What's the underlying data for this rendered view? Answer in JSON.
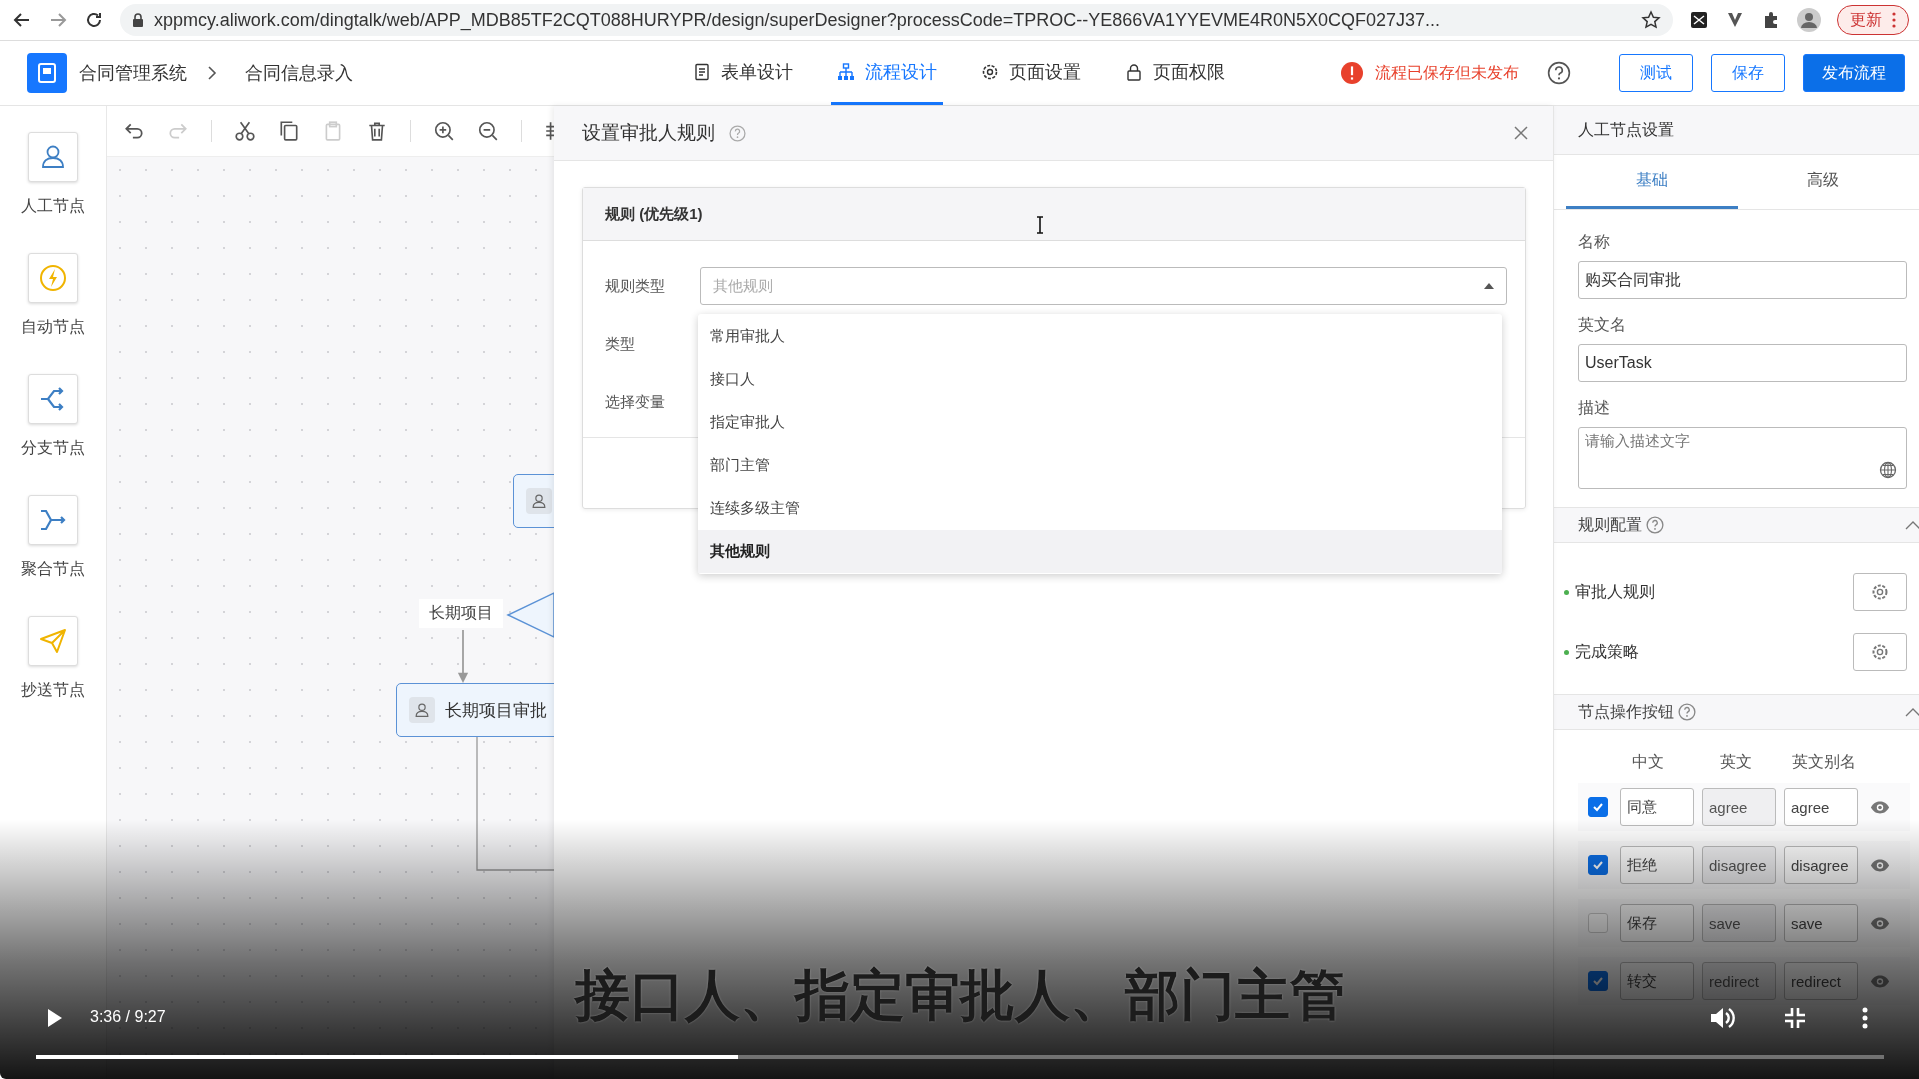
{
  "browser": {
    "url": "xppmcy.aliwork.com/dingtalk/web/APP_MDB85TF2CQT088HURYPR/design/superDesigner?processCode=TPROC--YE866VA1YYEVME4R0N5X0CQF027J37...",
    "update_button": "更新"
  },
  "header": {
    "breadcrumbs": [
      "合同管理系统",
      "合同信息录入"
    ],
    "tabs": [
      {
        "label": "表单设计",
        "kind": "form",
        "selected": false
      },
      {
        "label": "流程设计",
        "kind": "flow",
        "selected": true
      },
      {
        "label": "页面设置",
        "kind": "settings",
        "selected": false
      },
      {
        "label": "页面权限",
        "kind": "lock",
        "selected": false
      }
    ],
    "status": "流程已保存但未发布",
    "buttons": [
      {
        "label": "测试",
        "kind": "outline"
      },
      {
        "label": "保存",
        "kind": "outline"
      },
      {
        "label": "发布流程",
        "kind": "primary"
      }
    ]
  },
  "node_palette": [
    {
      "label": "人工节点",
      "kind": "person"
    },
    {
      "label": "自动节点",
      "kind": "auto"
    },
    {
      "label": "分支节点",
      "kind": "branch"
    },
    {
      "label": "聚合节点",
      "kind": "merge"
    },
    {
      "label": "抄送节点",
      "kind": "send"
    }
  ],
  "canvas": {
    "branch_label": "长期项目",
    "task_node": "长期项目审批"
  },
  "dialog": {
    "title": "设置审批人规则",
    "card_title": "规则 (优先级1)",
    "fields": [
      "规则类型",
      "类型",
      "选择变量"
    ],
    "select_value": "其他规则",
    "options": [
      {
        "label": "常用审批人",
        "selected": false
      },
      {
        "label": "接口人",
        "selected": false
      },
      {
        "label": "指定审批人",
        "selected": false
      },
      {
        "label": "部门主管",
        "selected": false
      },
      {
        "label": "连续多级主管",
        "selected": false
      },
      {
        "label": "其他规则",
        "selected": true
      }
    ]
  },
  "settings_panel": {
    "title": "人工节点设置",
    "tabs": [
      {
        "label": "基础",
        "selected": true
      },
      {
        "label": "高级",
        "selected": false
      }
    ],
    "name_label": "名称",
    "name_value": "购买合同审批",
    "en_label": "英文名",
    "en_value": "UserTask",
    "desc_label": "描述",
    "desc_placeholder": "请输入描述文字",
    "rule_section": "规则配置",
    "rules": [
      "审批人规则",
      "完成策略"
    ],
    "button_section": "节点操作按钮",
    "columns": [
      "中文",
      "英文",
      "英文别名"
    ],
    "buttons": [
      {
        "checked": true,
        "zh": "同意",
        "en": "agree",
        "alias": "agree"
      },
      {
        "checked": true,
        "zh": "拒绝",
        "en": "disagree",
        "alias": "disagree"
      },
      {
        "checked": false,
        "zh": "保存",
        "en": "save",
        "alias": "save"
      },
      {
        "checked": true,
        "zh": "转交",
        "en": "redirect",
        "alias": "redirect"
      }
    ]
  },
  "subtitle": "接口人、指定审批人、部门主管",
  "player": {
    "time": "3:36 / 9:27",
    "level": 0.38
  }
}
